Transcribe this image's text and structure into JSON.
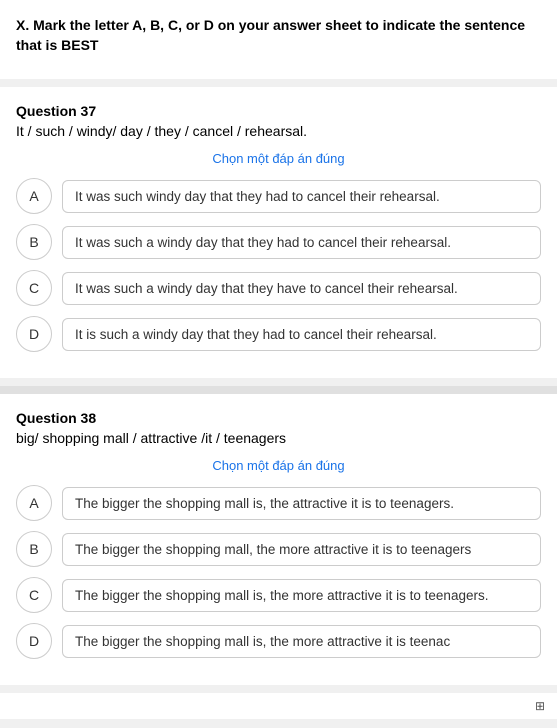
{
  "header": {
    "instruction": "X. Mark the letter A, B, C, or D on your answer sheet to indicate the sentence that is BEST"
  },
  "question37": {
    "title": "Question 37",
    "prompt": "It / such / windy/ day / they / cancel / rehearsal.",
    "choose_label": "Chọn một đáp án đúng",
    "options": [
      {
        "letter": "A",
        "text": "It was such windy day that they had to cancel their rehearsal."
      },
      {
        "letter": "B",
        "text": "It was such a windy day that they had to cancel their rehearsal."
      },
      {
        "letter": "C",
        "text": "It was such a windy day that they have to cancel their rehearsal."
      },
      {
        "letter": "D",
        "text": "It is such a windy day that they had to cancel their rehearsal."
      }
    ]
  },
  "question38": {
    "title": "Question 38",
    "prompt": "big/ shopping mall / attractive /it / teenagers",
    "choose_label": "Chọn một đáp án đúng",
    "options": [
      {
        "letter": "A",
        "text": "The bigger the shopping mall is, the attractive it is to teenagers."
      },
      {
        "letter": "B",
        "text": "The bigger the shopping mall, the more attractive it is to teenagers"
      },
      {
        "letter": "C",
        "text": "The bigger the shopping mall is, the more attractive it is to teenagers."
      },
      {
        "letter": "D",
        "text": "The bigger the shopping mall is, the more attractive it is teenac"
      }
    ]
  },
  "pagination": {
    "icon": "⊞"
  }
}
